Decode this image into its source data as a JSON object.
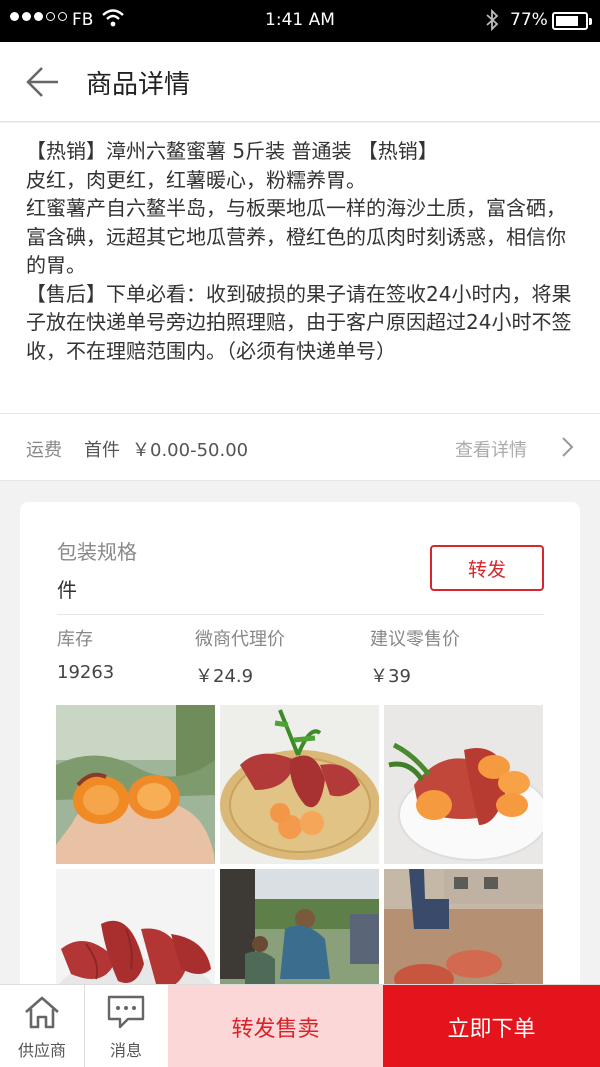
{
  "status_bar": {
    "carrier": "FB",
    "time": "1:41 AM",
    "battery": "77%"
  },
  "header": {
    "title": "商品详情"
  },
  "description": {
    "text": "【热销】漳州六鳌蜜薯 5斤装 普通装 【热销】\n皮红，肉更红，红薯暖心，粉糯养胃。\n红蜜薯产自六鳌半岛，与板栗地瓜一样的海沙土质，富含硒，富含碘，远超其它地瓜营养，橙红色的瓜肉时刻诱惑，相信你的胃。\n【售后】下单必看：收到破损的果子请在签收24小时内，将果子放在快递单号旁边拍照理赔，由于客户原因超过24小时不签收，不在理赔范围内。（必须有快递单号）"
  },
  "shipping": {
    "label": "运费",
    "first_item": "首件",
    "price_range": "￥0.00-50.00",
    "detail_link": "查看详情"
  },
  "spec_card": {
    "spec_label": "包装规格",
    "spec_value": "件",
    "forward_button": "转发",
    "stock_label": "库存",
    "stock_value": "19263",
    "agent_price_label": "微商代理价",
    "agent_price_value": "￥24.9",
    "retail_price_label": "建议零售价",
    "retail_price_value": "￥39"
  },
  "bottom_bar": {
    "supplier_label": "供应商",
    "message_label": "消息",
    "forward_sell_label": "转发售卖",
    "buy_now_label": "立即下单"
  },
  "colors": {
    "accent_red": "#e4141c",
    "light_red": "#fbd7d7"
  }
}
